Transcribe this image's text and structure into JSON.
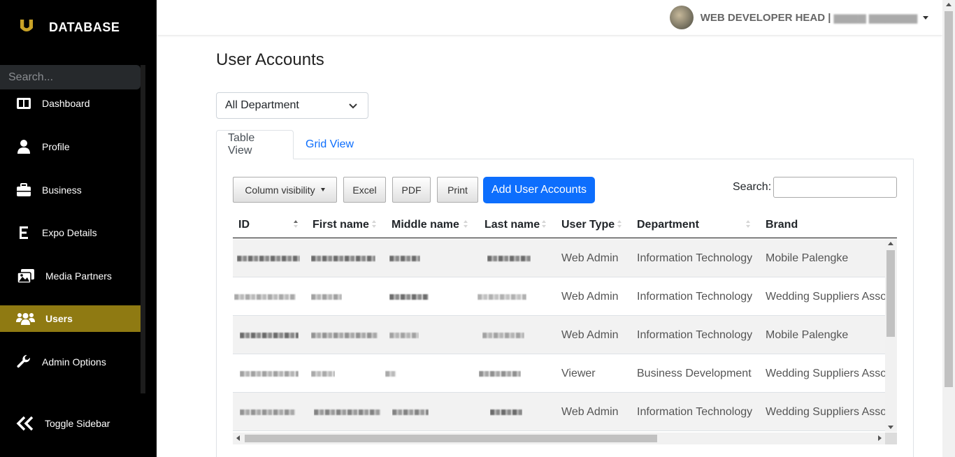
{
  "sidebar": {
    "brand": "DATABASE",
    "search_placeholder": "Search...",
    "items": [
      {
        "label": "Dashboard",
        "icon": "dashboard-icon"
      },
      {
        "label": "Profile",
        "icon": "user-icon"
      },
      {
        "label": "Business",
        "icon": "briefcase-icon"
      },
      {
        "label": "Expo Details",
        "icon": "letter-e-icon"
      },
      {
        "label": "Media Partners",
        "icon": "images-icon"
      },
      {
        "label": "Users",
        "icon": "users-icon",
        "active": true
      },
      {
        "label": "Admin Options",
        "icon": "wrench-icon"
      }
    ],
    "toggle_label": "Toggle Sidebar",
    "active_color": "#8f7a12"
  },
  "header": {
    "user_role": "WEB DEVELOPER HEAD |"
  },
  "main": {
    "title": "User Accounts",
    "department_filter": "All Department",
    "tabs": [
      {
        "label": "Table View",
        "active": true
      },
      {
        "label": "Grid View",
        "active": false
      }
    ],
    "toolbar": {
      "column_visibility": "Column visibility",
      "excel": "Excel",
      "pdf": "PDF",
      "print": "Print",
      "add": "Add User Accounts",
      "search_label": "Search:"
    },
    "columns": [
      "ID",
      "First name",
      "Middle name",
      "Last name",
      "User Type",
      "Department",
      "Brand"
    ],
    "rows": [
      {
        "user_type": "Web Admin",
        "department": "Information Technology",
        "brand": "Mobile Palengke"
      },
      {
        "user_type": "Web Admin",
        "department": "Information Technology",
        "brand": "Wedding Suppliers Asso"
      },
      {
        "user_type": "Web Admin",
        "department": "Information Technology",
        "brand": "Mobile Palengke"
      },
      {
        "user_type": "Viewer",
        "department": "Business Development",
        "brand": "Wedding Suppliers Asso"
      },
      {
        "user_type": "Web Admin",
        "department": "Information Technology",
        "brand": "Wedding Suppliers Asso"
      }
    ]
  },
  "colors": {
    "primary": "#0d6efd",
    "sidebar_bg": "#000000",
    "active": "#8f7a12"
  }
}
